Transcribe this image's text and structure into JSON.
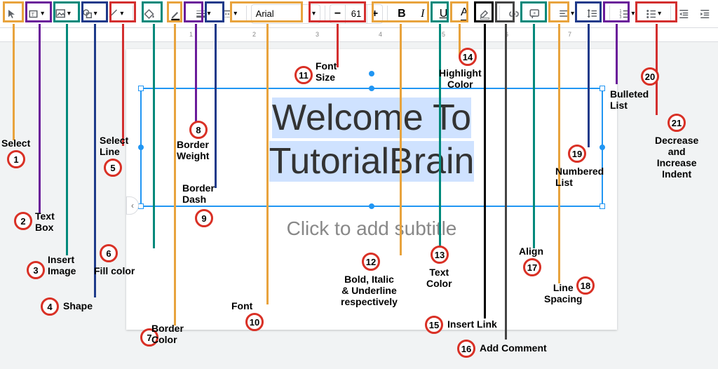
{
  "toolbar": {
    "font_name": "Arial",
    "font_size": "61",
    "minus": "−",
    "plus": "+",
    "bold": "B",
    "italic": "I",
    "underline": "U",
    "text_color": "A"
  },
  "slide": {
    "title_line1": "Welcome To",
    "title_line2": "TutorialBrain",
    "subtitle": "Click to add subtitle"
  },
  "ruler_ticks": [
    "1",
    "2",
    "3",
    "4",
    "5",
    "6",
    "7"
  ],
  "callouts": {
    "c1": {
      "n": "1",
      "label": "Select"
    },
    "c2": {
      "n": "2",
      "label": "Text\nBox"
    },
    "c3": {
      "n": "3",
      "label": "Insert\nImage"
    },
    "c4": {
      "n": "4",
      "label": "Shape"
    },
    "c5": {
      "n": "5",
      "label": "Select\nLine"
    },
    "c6": {
      "n": "6",
      "label": "Fill color"
    },
    "c7": {
      "n": "7",
      "label": "Border\nColor"
    },
    "c8": {
      "n": "8",
      "label": "Border\nWeight"
    },
    "c9": {
      "n": "9",
      "label": "Border\nDash"
    },
    "c10": {
      "n": "10",
      "label": "Font"
    },
    "c11": {
      "n": "11",
      "label": "Font\nSize"
    },
    "c12": {
      "n": "12",
      "label": "Bold, Italic\n& Underline\nrespectively"
    },
    "c13": {
      "n": "13",
      "label": "Text\nColor"
    },
    "c14": {
      "n": "14",
      "label": "Highlight\nColor"
    },
    "c15": {
      "n": "15",
      "label": "Insert Link"
    },
    "c16": {
      "n": "16",
      "label": "Add Comment"
    },
    "c17": {
      "n": "17",
      "label": "Align"
    },
    "c18": {
      "n": "18",
      "label": "Line\nSpacing"
    },
    "c19": {
      "n": "19",
      "label": "Numbered\nList"
    },
    "c20": {
      "n": "20",
      "label": "Bulleted\nList"
    },
    "c21": {
      "n": "21",
      "label": "Decrease\nand\nIncrease\nIndent"
    }
  }
}
